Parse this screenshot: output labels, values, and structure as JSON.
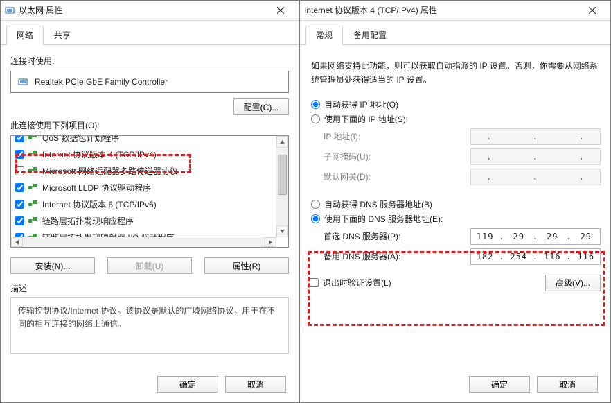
{
  "left": {
    "title": "以太网 属性",
    "tabs": [
      "网络",
      "共享"
    ],
    "active_tab": 0,
    "connect_using_label": "连接时使用:",
    "adapter_name": "Realtek PCIe GbE Family Controller",
    "configure_btn": "配置(C)...",
    "items_label": "此连接使用下列项目(O):",
    "items": [
      {
        "checked": true,
        "half_occluded": true,
        "label": "QoS 数据包计划程序"
      },
      {
        "checked": true,
        "label": "Internet 协议版本 4 (TCP/IPv4)"
      },
      {
        "checked": false,
        "label": "Microsoft 网络适配器多路传送器协议"
      },
      {
        "checked": true,
        "label": "Microsoft LLDP 协议驱动程序"
      },
      {
        "checked": true,
        "label": "Internet 协议版本 6 (TCP/IPv6)"
      },
      {
        "checked": true,
        "label": "链路层拓扑发现响应程序"
      },
      {
        "checked": true,
        "label": "链路层拓扑发现映射器 I/O 驱动程序"
      }
    ],
    "install_btn": "安装(N)...",
    "uninstall_btn": "卸载(U)",
    "properties_btn": "属性(R)",
    "desc_label": "描述",
    "desc_text": "传输控制协议/Internet 协议。该协议是默认的广域网络协议，用于在不同的相互连接的网络上通信。",
    "ok_btn": "确定",
    "cancel_btn": "取消"
  },
  "right": {
    "title": "Internet 协议版本 4 (TCP/IPv4) 属性",
    "tabs": [
      "常规",
      "备用配置"
    ],
    "active_tab": 0,
    "intro": "如果网络支持此功能，则可以获取自动指派的 IP 设置。否则，你需要从网络系统管理员处获得适当的 IP 设置。",
    "ip_auto_label": "自动获得 IP 地址(O)",
    "ip_manual_label": "使用下面的 IP 地址(S):",
    "ip_mode": "auto",
    "ip_address_label": "IP 地址(I):",
    "subnet_label": "子网掩码(U):",
    "gateway_label": "默认网关(D):",
    "dns_auto_label": "自动获得 DNS 服务器地址(B)",
    "dns_manual_label": "使用下面的 DNS 服务器地址(E):",
    "dns_mode": "manual",
    "dns_pref_label": "首选 DNS 服务器(P):",
    "dns_alt_label": "备用 DNS 服务器(A):",
    "dns_pref_value": [
      "119",
      "29",
      "29",
      "29"
    ],
    "dns_alt_value": [
      "182",
      "254",
      "116",
      "116"
    ],
    "validate_label": "退出时验证设置(L)",
    "validate_checked": false,
    "advanced_btn": "高级(V)...",
    "ok_btn": "确定",
    "cancel_btn": "取消"
  }
}
